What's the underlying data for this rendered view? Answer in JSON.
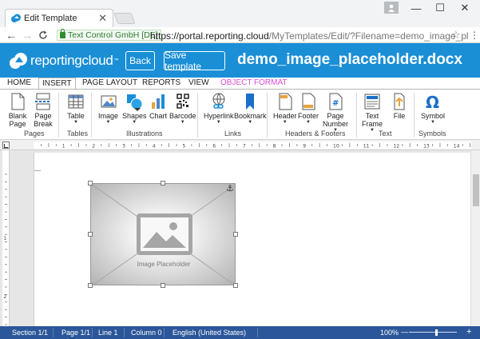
{
  "browser": {
    "tab_title": "Edit Template",
    "tab_close": "✕",
    "window_controls": {
      "minimize": "—",
      "maximize": "☐",
      "close": "✕"
    },
    "nav": {
      "back": "←",
      "forward": "→",
      "reload": "C"
    },
    "security_label": "Text Control GmbH [DE]",
    "url_host": "https://portal.reporting.cloud",
    "url_path": "/MyTemplates/Edit/?Filename=demo_image_pl",
    "bookmark_icon": "☆",
    "menu_icon": "⋮"
  },
  "app": {
    "logo_text": "reportingcloud",
    "logo_tm": "™",
    "back_label": "Back",
    "save_label": "Save template",
    "doc_title": "demo_image_placeholder.docx"
  },
  "ribbon": {
    "tabs": [
      "HOME",
      "INSERT",
      "PAGE LAYOUT",
      "REPORTS",
      "VIEW",
      "OBJECT FORMAT"
    ],
    "active_tab": "INSERT",
    "buttons": {
      "blank_page": [
        "Blank",
        "Page"
      ],
      "page_break": [
        "Page",
        "Break"
      ],
      "table": "Table",
      "image": "Image",
      "shapes": "Shapes",
      "chart": "Chart",
      "barcode": "Barcode",
      "hyperlink": "Hyperlink",
      "bookmark": "Bookmark",
      "header": "Header",
      "footer": "Footer",
      "page_number": [
        "Page",
        "Number"
      ],
      "text_frame": [
        "Text",
        "Frame"
      ],
      "file": "File",
      "symbol": "Symbol"
    },
    "dropdown_glyph": "▼",
    "groups": [
      "Pages",
      "Tables",
      "Illustrations",
      "Links",
      "Headers & Footers",
      "Text",
      "Symbols"
    ]
  },
  "ruler": {
    "h_numbers": [
      "1",
      "2",
      "3",
      "4",
      "5",
      "6",
      "7",
      "8",
      "9",
      "10",
      "11",
      "12",
      "13",
      "14"
    ],
    "v_numbers": [
      "1",
      "2"
    ]
  },
  "document": {
    "placeholder_caption": "Image Placeholder",
    "anchor_glyph": "⚓"
  },
  "status": {
    "section": "Section 1/1",
    "page": "Page 1/1",
    "line": "Line 1",
    "column": "Column 0",
    "language": "English (United States)",
    "zoom": "100%",
    "zoom_out": "—",
    "zoom_in": "+"
  }
}
